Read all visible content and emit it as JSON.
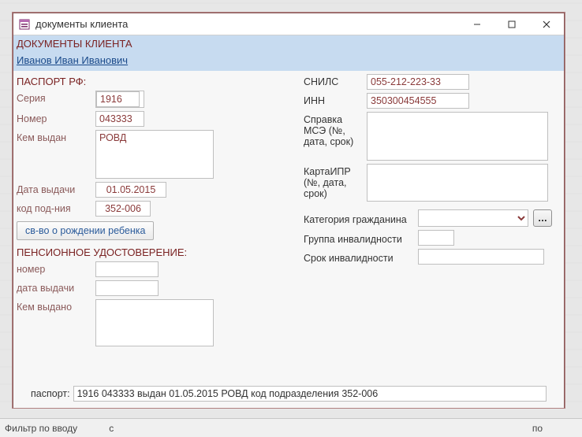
{
  "window": {
    "title": "документы клиента",
    "minimize_icon": "minimize-icon",
    "maximize_icon": "maximize-icon",
    "close_icon": "close-icon"
  },
  "header": {
    "title": "ДОКУМЕНТЫ КЛИЕНТА",
    "client_name": "Иванов Иван Иванович"
  },
  "passport": {
    "section": "ПАСПОРТ РФ:",
    "labels": {
      "seria": "Серия",
      "nomer": "Номер",
      "kem_vydan": "Кем выдан",
      "data_vydachi": "Дата выдачи",
      "kod_podr": "код под-ния"
    },
    "seria": "1916",
    "nomer": "043333",
    "kem_vydan": "РОВД",
    "data_vydachi": "01.05.2015",
    "kod_podr": "352-006"
  },
  "birth_cert_btn": "св-во о рождении ребенка",
  "pension": {
    "section": "ПЕНСИОННОЕ УДОСТОВЕРЕНИЕ:",
    "labels": {
      "nomer": "номер",
      "data_vydachi": "дата выдачи",
      "kem_vydano": "Кем выдано"
    },
    "nomer": "",
    "data_vydachi": "",
    "kem_vydano": ""
  },
  "right": {
    "labels": {
      "snils": "СНИЛС",
      "inn": "ИНН",
      "spravka_mse": "Справка МСЭ (№, дата, срок)",
      "karta_ipr": "КартаИПР (№, дата, срок)",
      "kategoria": "Категория гражданина",
      "gruppa_inv": "Группа инвалидности",
      "srok_inv": "Срок инвалидности"
    },
    "snils": "055-212-223-33",
    "inn": "350300454555",
    "spravka_mse": "",
    "karta_ipr": "",
    "kategoria": "",
    "gruppa_inv": "",
    "srok_inv": ""
  },
  "footer": {
    "label": "паспорт:",
    "value": "1916 043333 выдан 01.05.2015 РОВД код подразделения 352-006"
  },
  "statusbar": {
    "filter": "Фильтр по вводу",
    "s_label": "с",
    "po_label": "по"
  }
}
